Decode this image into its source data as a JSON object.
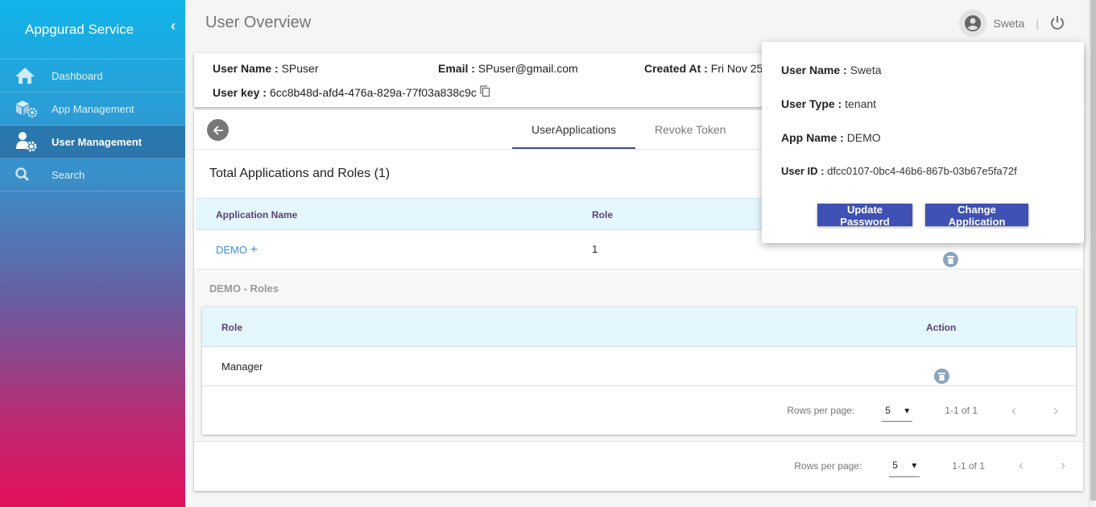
{
  "sidebar": {
    "brand": "Appgurad Service",
    "items": [
      {
        "label": "Dashboard",
        "icon": "home-icon"
      },
      {
        "label": "App Management",
        "icon": "app-gear-icon"
      },
      {
        "label": "User Management",
        "icon": "user-gear-icon",
        "active": true
      },
      {
        "label": "Search",
        "icon": "search-icon"
      }
    ]
  },
  "header": {
    "title": "User Overview",
    "user": "Sweta",
    "separator": "|"
  },
  "info": {
    "username_label": "User Name :",
    "username": "SPuser",
    "email_label": "Email :",
    "email": "SPuser@gmail.com",
    "created_label": "Created At :",
    "created": "Fri Nov 25",
    "key_label": "User key :",
    "key": "6cc8b48d-afd4-476a-829a-77f03a838c9c"
  },
  "tabs": [
    {
      "label": "UserApplications",
      "active": true
    },
    {
      "label": "Revoke Token"
    }
  ],
  "total": "Total Applications and Roles (1)",
  "apps_table": {
    "headers": [
      "Application Name",
      "Role"
    ],
    "rows": [
      {
        "name": "DEMO",
        "plus": "+",
        "role": "1"
      }
    ]
  },
  "roles": {
    "title": "DEMO - Roles",
    "headers": [
      "Role",
      "Action"
    ],
    "rows": [
      {
        "role": "Manager"
      }
    ],
    "pagination": {
      "rows_label": "Rows per page:",
      "rows_value": "5",
      "range": "1-1 of 1"
    }
  },
  "pagination": {
    "rows_label": "Rows per page:",
    "rows_value": "5",
    "range": "1-1 of 1"
  },
  "popup": {
    "username_label": "User Name :",
    "username": "Sweta",
    "type_label": "User Type :",
    "type": "tenant",
    "app_label": "App Name :",
    "app": "DEMO",
    "id_label": "User ID :",
    "id": "dfcc0107-0bc4-46b6-867b-03b67e5fa72f",
    "update_btn": "Update Password",
    "change_btn": "Change Application"
  },
  "colors": {
    "accent": "#3f51b5",
    "header_bg": "#e3f7fd",
    "link": "#3d8fd6"
  }
}
